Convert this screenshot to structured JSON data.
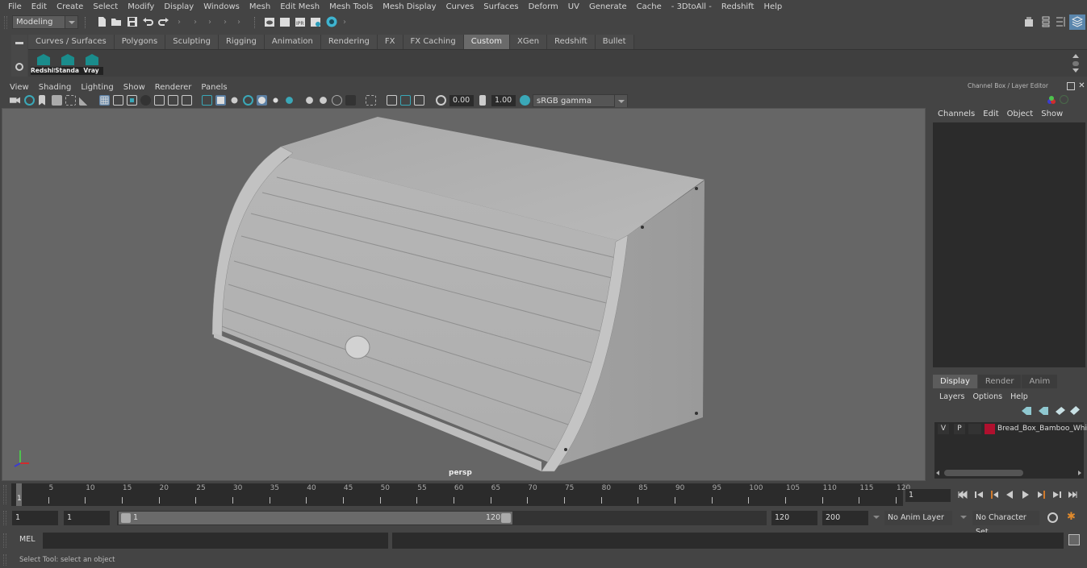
{
  "menubar": {
    "items": [
      "File",
      "Edit",
      "Create",
      "Select",
      "Modify",
      "Display",
      "Windows",
      "Mesh",
      "Edit Mesh",
      "Mesh Tools",
      "Mesh Display",
      "Curves",
      "Surfaces",
      "Deform",
      "UV",
      "Generate",
      "Cache",
      "- 3DtoAll -",
      "Redshift",
      "Help"
    ]
  },
  "toolbar": {
    "workspace_dropdown": "Modeling",
    "icons": [
      "new-scene-icon",
      "open-scene-icon",
      "save-scene-icon",
      "undo-icon",
      "redo-icon",
      "render-view-icon",
      "render-frame-icon",
      "ipr-render-icon",
      "render-settings-icon",
      "hypershade-icon"
    ],
    "right_icons": [
      "modeling-toolkit-icon",
      "attribute-editor-icon",
      "tool-settings-icon",
      "channel-box-icon"
    ]
  },
  "shelf": {
    "tabs": [
      "Curves / Surfaces",
      "Polygons",
      "Sculpting",
      "Rigging",
      "Animation",
      "Rendering",
      "FX",
      "FX Caching",
      "Custom",
      "XGen",
      "Redshift",
      "Bullet"
    ],
    "active_tab": "Custom",
    "buttons": [
      "Redshif",
      "Standa",
      "Vray"
    ]
  },
  "viewport": {
    "menu": [
      "View",
      "Shading",
      "Lighting",
      "Show",
      "Renderer",
      "Panels"
    ],
    "exposure_value": "0.00",
    "gamma_value": "1.00",
    "color_space": "sRGB gamma",
    "camera_label": "persp",
    "object_name": "Bread Box"
  },
  "right_panel": {
    "title": "Channel Box / Layer Editor",
    "channel_menu": [
      "Channels",
      "Edit",
      "Object",
      "Show"
    ],
    "layer_tabs": [
      "Display",
      "Render",
      "Anim"
    ],
    "active_layer_tab": "Display",
    "layer_menu": [
      "Layers",
      "Options",
      "Help"
    ],
    "layers": [
      {
        "visible": "V",
        "playback": "P",
        "color": "#b0102e",
        "name": "Bread_Box_Bamboo_Whi"
      }
    ]
  },
  "timeline": {
    "ticks": [
      5,
      10,
      15,
      20,
      25,
      30,
      35,
      40,
      45,
      50,
      55,
      60,
      65,
      70,
      75,
      80,
      85,
      90,
      95,
      100,
      105,
      110,
      115,
      120
    ],
    "current_frame_marker": "1",
    "current_frame_field": "1",
    "min_frame": 1,
    "max_frame": 120
  },
  "range": {
    "start_field": "1",
    "playback_start_field": "1",
    "slider_start_label": "1",
    "slider_end_label": "120",
    "playback_end_field": "120",
    "end_field": "200",
    "anim_layer": "No Anim Layer",
    "character_set": "No Character Set"
  },
  "command_line": {
    "language": "MEL",
    "value": "",
    "result": ""
  },
  "status_line": "Select Tool: select an object"
}
